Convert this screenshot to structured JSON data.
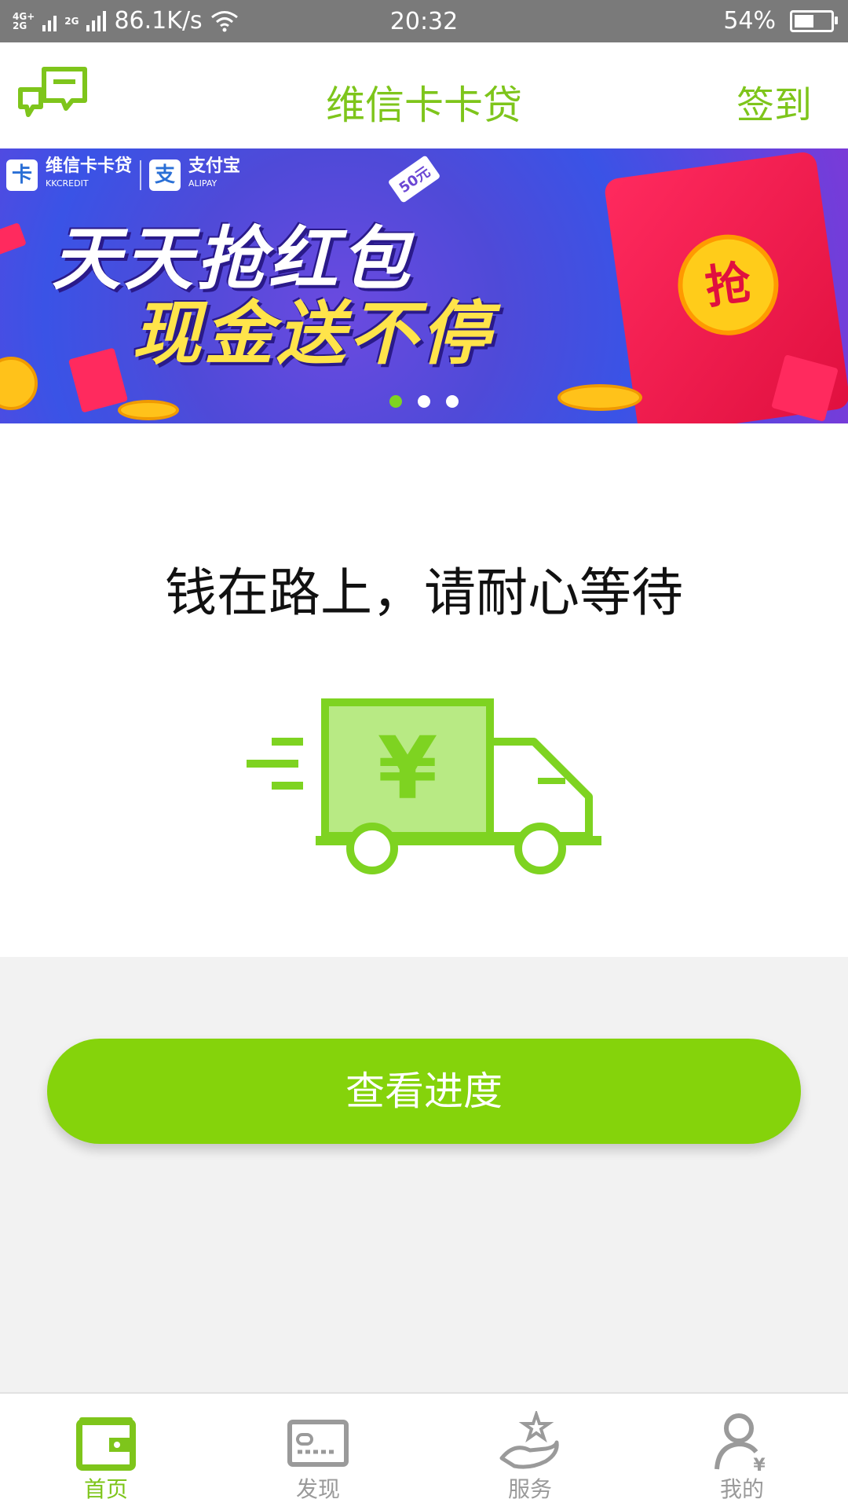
{
  "status_bar": {
    "network_top": "4G+",
    "network_bottom": "2G",
    "network_second": "2G",
    "speed": "86.1K/s",
    "time": "20:32",
    "battery": "54%",
    "battery_level": 0.54
  },
  "header": {
    "title": "维信卡卡贷",
    "signin_label": "签到",
    "icon": "chat-bubbles-icon"
  },
  "banner": {
    "brand": "维信卡卡贷",
    "brand_sub": "KKCREDIT",
    "partner": "支付宝",
    "partner_sub": "ALIPAY",
    "line1": "天天抢红包",
    "line2": "现金送不停",
    "tag": "50元",
    "packet_label": "抢",
    "dots": 3,
    "active_dot": 0
  },
  "main": {
    "message": "钱在路上，请耐心等待",
    "illustration": "money-truck-icon",
    "currency": "¥"
  },
  "actions": {
    "check_progress": "查看进度"
  },
  "tabs": [
    {
      "label": "首页",
      "icon": "wallet-icon",
      "active": true
    },
    {
      "label": "发现",
      "icon": "card-icon",
      "active": false
    },
    {
      "label": "服务",
      "icon": "hand-star-icon",
      "active": false
    },
    {
      "label": "我的",
      "icon": "user-yen-icon",
      "active": false
    }
  ],
  "colors": {
    "accent": "#7ec51b",
    "button": "#85d30b",
    "status_bar": "#7a7a7a"
  }
}
